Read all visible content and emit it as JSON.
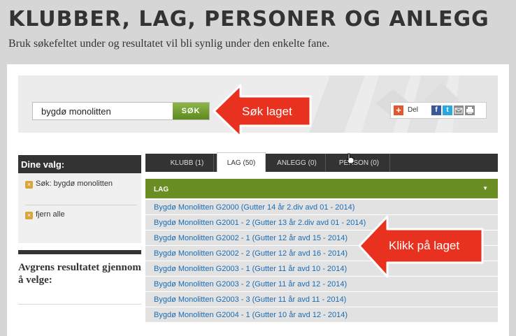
{
  "page": {
    "title": "KLUBBER, LAG, PERSONER OG ANLEGG",
    "subtitle": "Bruk søkefeltet under og resultatet vil bli synlig under den enkelte fane."
  },
  "search": {
    "value": "bygdø monolitten",
    "button_label": "SØK"
  },
  "share": {
    "label": "Del",
    "icons": [
      "plus-icon",
      "facebook-icon",
      "twitter-icon",
      "email-icon",
      "print-icon"
    ]
  },
  "callouts": {
    "search": "Søk laget",
    "list": "Klikk på laget"
  },
  "sidebar": {
    "header": "Dine valg:",
    "chips": [
      {
        "label": "Søk: bygdø monolitten"
      },
      {
        "label": "fjern alle"
      }
    ],
    "filter_heading": "Avgrens resultatet gjennom å velge:"
  },
  "tabs": [
    {
      "label": "KLUBB (1)",
      "active": false
    },
    {
      "label": "LAG (50)",
      "active": true
    },
    {
      "label": "ANLEGG (0)",
      "active": false
    },
    {
      "label": "PERSON (0)",
      "active": false
    }
  ],
  "results": {
    "header": "LAG",
    "rows": [
      "Bygdø Monolitten G2000 (Gutter 14 år 2.div avd 01 - 2014)",
      "Bygdø Monolitten G2001 - 2 (Gutter 13 år 2.div avd 01 - 2014)",
      "Bygdø Monolitten G2002 - 1 (Gutter 12 år avd 15 - 2014)",
      "Bygdø Monolitten G2002 - 2 (Gutter 12 år avd 16 - 2014)",
      "Bygdø Monolitten G2003 - 1 (Gutter 11 år avd 10 - 2014)",
      "Bygdø Monolitten G2003 - 2 (Gutter 11 år avd 12 - 2014)",
      "Bygdø Monolitten G2003 - 3 (Gutter 11 år avd 11 - 2014)",
      "Bygdø Monolitten G2004 - 1 (Gutter 10 år avd 12 - 2014)"
    ]
  },
  "colors": {
    "accent_green": "#6a8e23",
    "callout_red": "#e8321f",
    "link_blue": "#1b6db3"
  }
}
